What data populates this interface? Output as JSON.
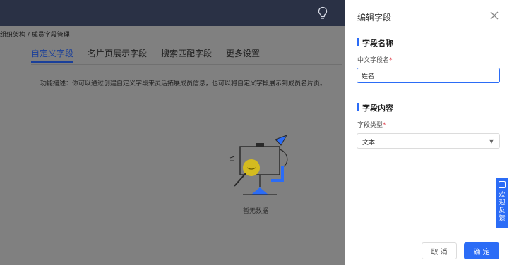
{
  "topbar": {
    "icon": "lightbulb-icon"
  },
  "breadcrumb": {
    "text": "组织架构 / 成员字段管理"
  },
  "tabs": [
    {
      "label": "自定义字段",
      "active": true
    },
    {
      "label": "名片页展示字段",
      "active": false
    },
    {
      "label": "搜索匹配字段",
      "active": false
    },
    {
      "label": "更多设置",
      "active": false
    }
  ],
  "description": "功能描述：你可以通过创建自定义字段来灵活拓展成员信息，也可以将自定义字段展示到成员名片页。",
  "empty": {
    "text": "暂无数据",
    "icon": "empty-state-illustration"
  },
  "drawer": {
    "title": "编辑字段",
    "close_icon": "close-icon",
    "section_name": {
      "title": "字段名称"
    },
    "name_field": {
      "label": "中文字段名",
      "required": "*",
      "value": "姓名"
    },
    "section_content": {
      "title": "字段内容"
    },
    "type_field": {
      "label": "字段类型",
      "required": "*",
      "value": "文本"
    },
    "cancel_label": "取 消",
    "ok_label": "确 定"
  },
  "feedback": {
    "label": "欢迎反馈",
    "icon": "message-icon"
  },
  "colors": {
    "primary": "#2b6cf6",
    "topbar": "#2a3145",
    "overlay": "#7a7a7a",
    "required": "#e34d59"
  }
}
